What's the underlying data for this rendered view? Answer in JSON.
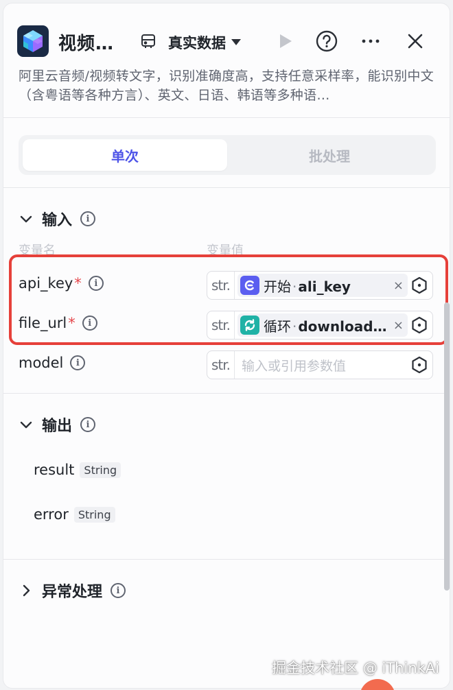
{
  "header": {
    "title": "视频…",
    "data_mode": "真实数据",
    "description": "阿里云音频/视频转文字，识别准确度高，支持任意采样率，能识别中文（含粤语等各种方言）、英文、日语、韩语等多种语…"
  },
  "tabs": [
    {
      "label": "单次",
      "active": true
    },
    {
      "label": "批处理",
      "active": false
    }
  ],
  "input_section": {
    "title": "输入",
    "col_name": "变量名",
    "col_value": "变量值",
    "rows": [
      {
        "name": "api_key",
        "required": "*",
        "type": "str.",
        "ref_node": "开始",
        "ref_sep": "·",
        "ref_var": "ali_key",
        "ref_color": "#5b5ef0"
      },
      {
        "name": "file_url",
        "required": "*",
        "type": "str.",
        "ref_node": "循环",
        "ref_sep": "·",
        "ref_var": "download…",
        "ref_color": "#20b2a6"
      },
      {
        "name": "model",
        "type": "str.",
        "placeholder": "输入或引用参数值"
      }
    ]
  },
  "output_section": {
    "title": "输出",
    "rows": [
      {
        "name": "result",
        "type": "String"
      },
      {
        "name": "error",
        "type": "String"
      }
    ]
  },
  "exception_section": {
    "title": "异常处理"
  },
  "watermark": "掘金技术社区 @ iThinkAi",
  "icons": {
    "logo": "app-cube-icon",
    "mode": "database-icon",
    "run": "play-icon",
    "help": "help-icon",
    "more": "more-icon",
    "close": "close-icon"
  },
  "colors": {
    "accent": "#4d53e8",
    "highlight": "#e6403a",
    "required": "#e5484d"
  }
}
